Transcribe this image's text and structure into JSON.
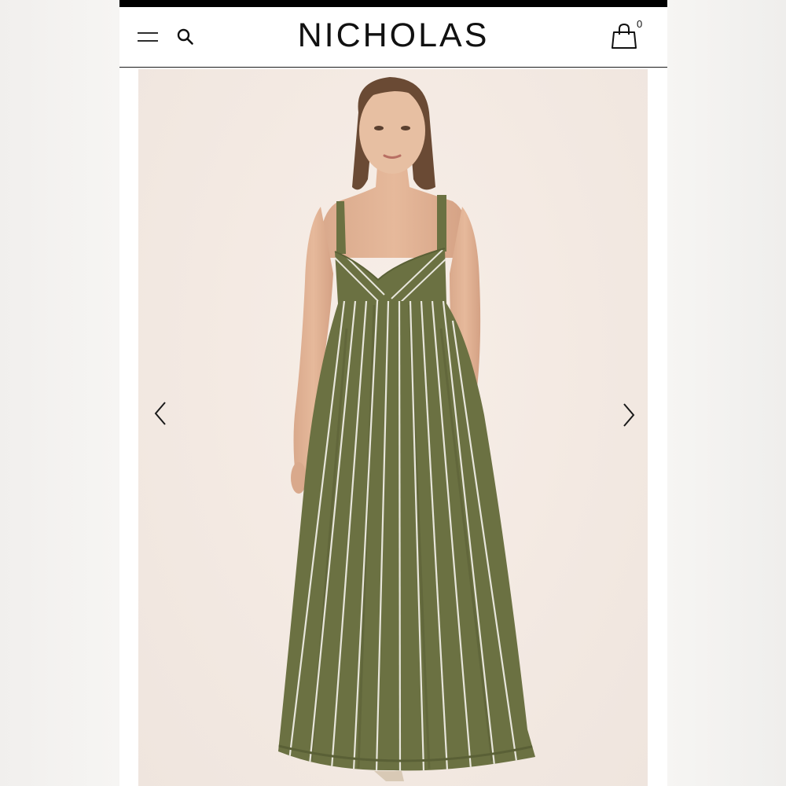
{
  "header": {
    "brand": "NICHOLAS",
    "cart_count": "0",
    "icons": [
      "menu-icon",
      "search-icon",
      "shopping-bag-icon"
    ]
  },
  "gallery": {
    "image": "product-photo-model-green-striped-dress",
    "arrows": [
      "chevron-left-icon",
      "chevron-right-icon"
    ]
  },
  "colors": {
    "dress": "#6b7142",
    "stripe": "#e8e6dc",
    "background": "#f4ebe4",
    "text": "#111111"
  }
}
